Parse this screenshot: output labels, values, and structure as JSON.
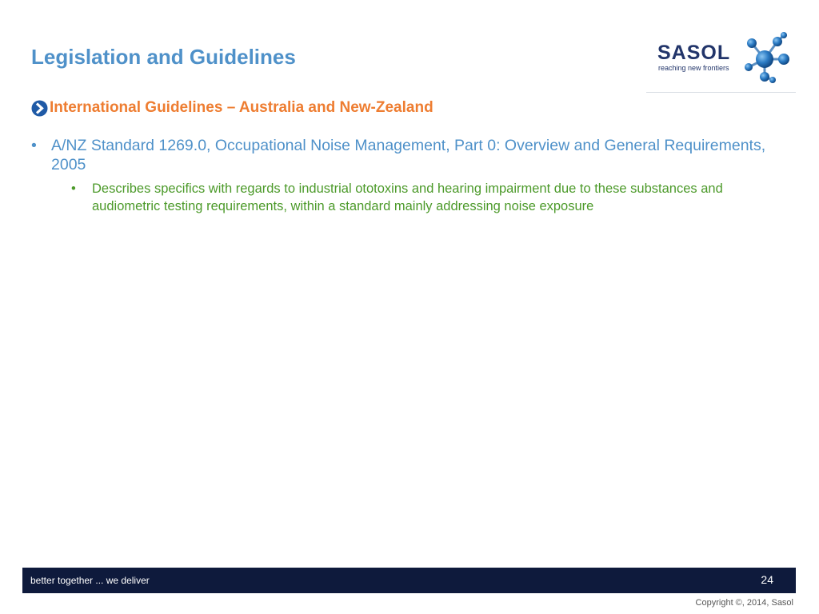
{
  "slide": {
    "title": "Legislation and Guidelines",
    "logo": {
      "wordmark": "SASOL",
      "tagline": "reaching new frontiers"
    },
    "subheading": "International Guidelines – Australia and New-Zealand",
    "bullets": [
      {
        "text": "A/NZ Standard 1269.0,  Occupational Noise Management, Part 0: Overview and General Requirements, 2005",
        "sub_bullets": [
          {
            "text": "Describes specifics with regards to industrial ototoxins and hearing impairment due to these substances and audiometric testing requirements, within a standard mainly addressing noise exposure"
          }
        ]
      }
    ],
    "bullet_glyph": "•",
    "footer": {
      "tagline": "better together ... we deliver",
      "page_number": "24",
      "copyright": "Copyright ©, 2014, Sasol"
    },
    "colors": {
      "title": "#4f91c9",
      "subheading": "#ee7d31",
      "bullet_level_1": "#4f91c9",
      "bullet_level_2": "#4c9a2a",
      "footer_bar": "#0e1a3c",
      "logo_navy": "#22356a",
      "logo_blue": "#2b7bc4"
    },
    "icons": {
      "subheading_marker": "chevron-right-icon",
      "logo_mark": "molecule-icon"
    }
  }
}
